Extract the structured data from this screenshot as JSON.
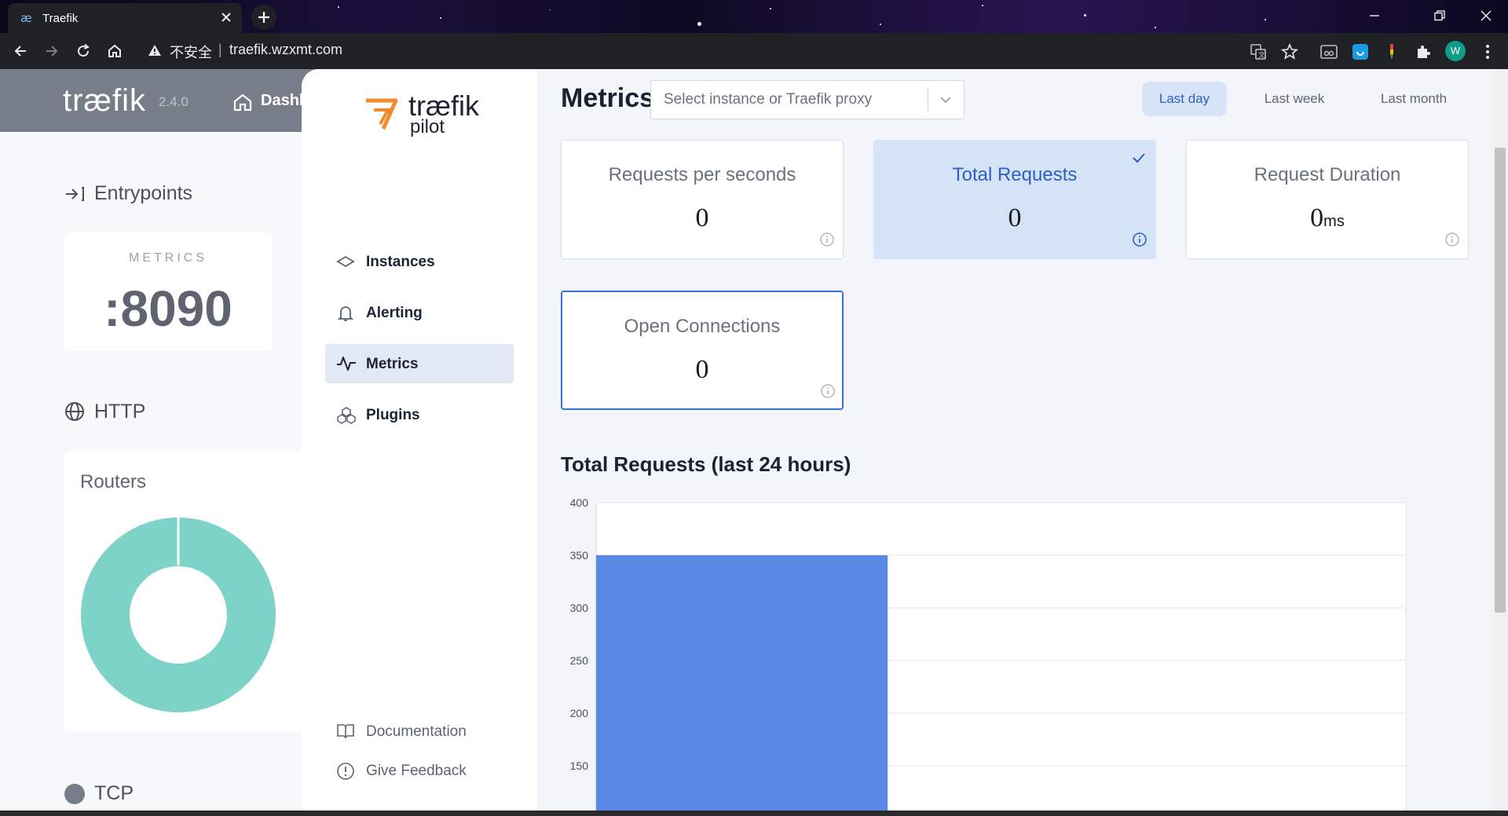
{
  "browser": {
    "tab_title": "Traefik",
    "insecure_label": "不安全",
    "url_separator": "|",
    "url": "traefik.wzxmt.com",
    "profile_initial": "W"
  },
  "dashboard": {
    "logo": "træfik",
    "version": "2.4.0",
    "nav_dashboard": "Dashboard",
    "entrypoints_heading": "Entrypoints",
    "entrypoint_card": {
      "label": "METRICS",
      "value": ":8090"
    },
    "http_heading": "HTTP",
    "routers_heading": "Routers",
    "tcp_heading": "TCP"
  },
  "pilot": {
    "logo_line1": "træfik",
    "logo_line2": "pilot",
    "nav": [
      {
        "label": "Instances",
        "icon": "instances-icon"
      },
      {
        "label": "Alerting",
        "icon": "bell-icon"
      },
      {
        "label": "Metrics",
        "icon": "pulse-icon",
        "active": true
      },
      {
        "label": "Plugins",
        "icon": "plugins-icon"
      }
    ],
    "footer_nav": [
      {
        "label": "Documentation",
        "icon": "book-icon"
      },
      {
        "label": "Give Feedback",
        "icon": "feedback-icon"
      }
    ]
  },
  "metrics": {
    "title": "Metrics",
    "selector_placeholder": "Select instance or Traefik proxy",
    "ranges": [
      "Last day",
      "Last week",
      "Last month"
    ],
    "active_range": "Last day",
    "cards": [
      {
        "title": "Requests per seconds",
        "value": "0",
        "unit": ""
      },
      {
        "title": "Total Requests",
        "value": "0",
        "unit": "",
        "selected": true
      },
      {
        "title": "Request Duration",
        "value": "0",
        "unit": "ms"
      },
      {
        "title": "Open Connections",
        "value": "0",
        "unit": ""
      }
    ],
    "chart_title": "Total Requests (last 24 hours)"
  },
  "colors": {
    "accent": "#2d5fc4",
    "bar": "#5b8ae6",
    "donut": "#7dd3c8",
    "traefik_orange": "#f38b2c"
  },
  "chart_data": {
    "type": "bar",
    "title": "Total Requests (last 24 hours)",
    "y_ticks": [
      400,
      350,
      300,
      250,
      200,
      150
    ],
    "ylim": [
      140,
      400
    ],
    "bars": [
      {
        "x_start": 0,
        "x_end": 0.36,
        "value": 350
      }
    ],
    "grid": true
  }
}
